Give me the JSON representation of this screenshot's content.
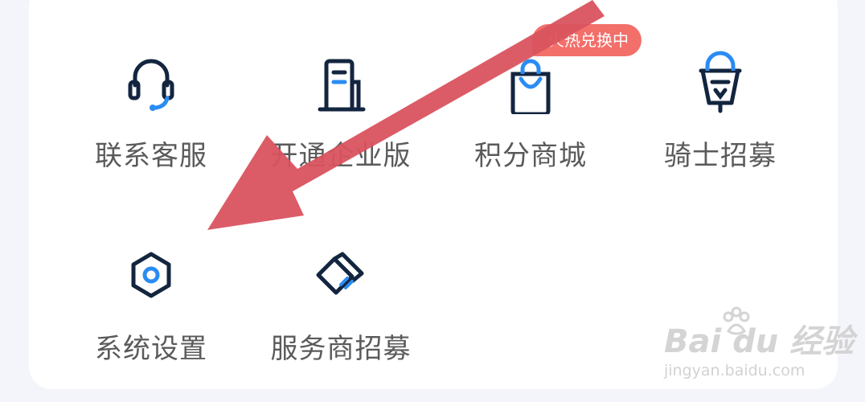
{
  "grid": {
    "items": [
      {
        "label": "联系客服",
        "icon": "headset-icon"
      },
      {
        "label": "开通企业版",
        "icon": "building-icon"
      },
      {
        "label": "积分商城",
        "icon": "shopping-bag-icon"
      },
      {
        "label": "骑士招募",
        "icon": "scooter-icon"
      },
      {
        "label": "系统设置",
        "icon": "settings-hexagon-icon"
      },
      {
        "label": "服务商招募",
        "icon": "handshake-card-icon"
      }
    ]
  },
  "badge": {
    "text": "火热兑换中",
    "color": "#f36f6a"
  },
  "annotation": {
    "arrow_color": "#d9535f"
  },
  "watermark": {
    "logo": "Bai du 经验",
    "url": "jingyan.baidu.com"
  },
  "colors": {
    "icon_dark": "#13253f",
    "icon_accent": "#2a8cf3",
    "label": "#5a5a5a"
  }
}
